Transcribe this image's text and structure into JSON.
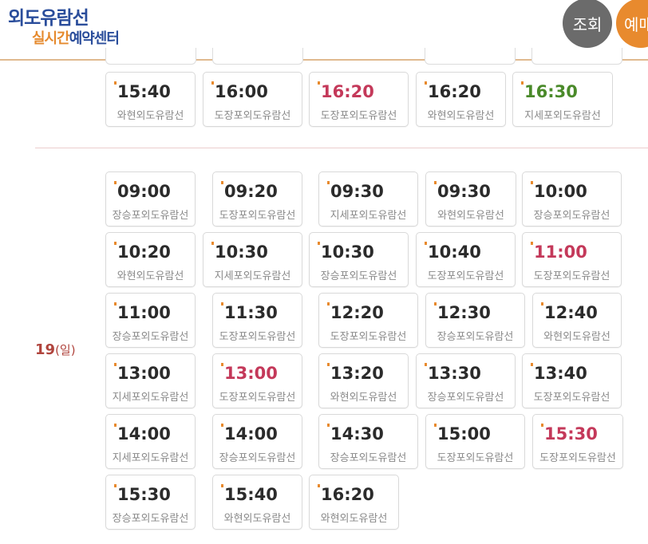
{
  "header": {
    "logo_title": "외도유람선",
    "logo_sub_orange": "실시간",
    "logo_sub_blue": "예약센터",
    "lookup_label": "조회",
    "reserve_label": "예매"
  },
  "colors": {
    "accent": "#e88a2e",
    "brand": "#2a4d9b",
    "red_time": "#c4395a",
    "green_time": "#4a8a2a"
  },
  "prev_day": {
    "slots": [
      {
        "time": "15:40",
        "route": "와현외도유람선",
        "color": "normal"
      },
      {
        "time": "16:00",
        "route": "도장포외도유람선",
        "color": "normal"
      },
      {
        "time": "16:20",
        "route": "도장포외도유람선",
        "color": "red"
      },
      {
        "time": "16:20",
        "route": "와현외도유람선",
        "color": "normal"
      },
      {
        "time": "16:30",
        "route": "지세포외도유람선",
        "color": "green"
      }
    ]
  },
  "day19": {
    "day_num": "19",
    "weekday": "(일)",
    "slots": [
      {
        "time": "09:00",
        "route": "장승포외도유람선",
        "color": "normal"
      },
      {
        "time": "09:20",
        "route": "도장포외도유람선",
        "color": "normal"
      },
      {
        "time": "09:30",
        "route": "지세포외도유람선",
        "color": "normal"
      },
      {
        "time": "09:30",
        "route": "와현외도유람선",
        "color": "normal"
      },
      {
        "time": "10:00",
        "route": "장승포외도유람선",
        "color": "normal"
      },
      {
        "time": "10:20",
        "route": "와현외도유람선",
        "color": "normal"
      },
      {
        "time": "10:30",
        "route": "지세포외도유람선",
        "color": "normal"
      },
      {
        "time": "10:30",
        "route": "장승포외도유람선",
        "color": "normal"
      },
      {
        "time": "10:40",
        "route": "도장포외도유람선",
        "color": "normal"
      },
      {
        "time": "11:00",
        "route": "도장포외도유람선",
        "color": "red"
      },
      {
        "time": "11:00",
        "route": "장승포외도유람선",
        "color": "normal"
      },
      {
        "time": "11:30",
        "route": "도장포외도유람선",
        "color": "normal"
      },
      {
        "time": "12:20",
        "route": "도장포외도유람선",
        "color": "normal"
      },
      {
        "time": "12:30",
        "route": "장승포외도유람선",
        "color": "normal"
      },
      {
        "time": "12:40",
        "route": "와현외도유람선",
        "color": "normal"
      },
      {
        "time": "13:00",
        "route": "지세포외도유람선",
        "color": "normal"
      },
      {
        "time": "13:00",
        "route": "도장포외도유람선",
        "color": "red"
      },
      {
        "time": "13:20",
        "route": "와현외도유람선",
        "color": "normal"
      },
      {
        "time": "13:30",
        "route": "장승포외도유람선",
        "color": "normal"
      },
      {
        "time": "13:40",
        "route": "도장포외도유람선",
        "color": "normal"
      },
      {
        "time": "14:00",
        "route": "지세포외도유람선",
        "color": "normal"
      },
      {
        "time": "14:00",
        "route": "장승포외도유람선",
        "color": "normal"
      },
      {
        "time": "14:30",
        "route": "장승포외도유람선",
        "color": "normal"
      },
      {
        "time": "15:00",
        "route": "도장포외도유람선",
        "color": "normal"
      },
      {
        "time": "15:30",
        "route": "도장포외도유람선",
        "color": "red"
      },
      {
        "time": "15:30",
        "route": "장승포외도유람선",
        "color": "normal"
      },
      {
        "time": "15:40",
        "route": "와현외도유람선",
        "color": "normal"
      },
      {
        "time": "16:20",
        "route": "와현외도유람선",
        "color": "normal"
      }
    ]
  }
}
